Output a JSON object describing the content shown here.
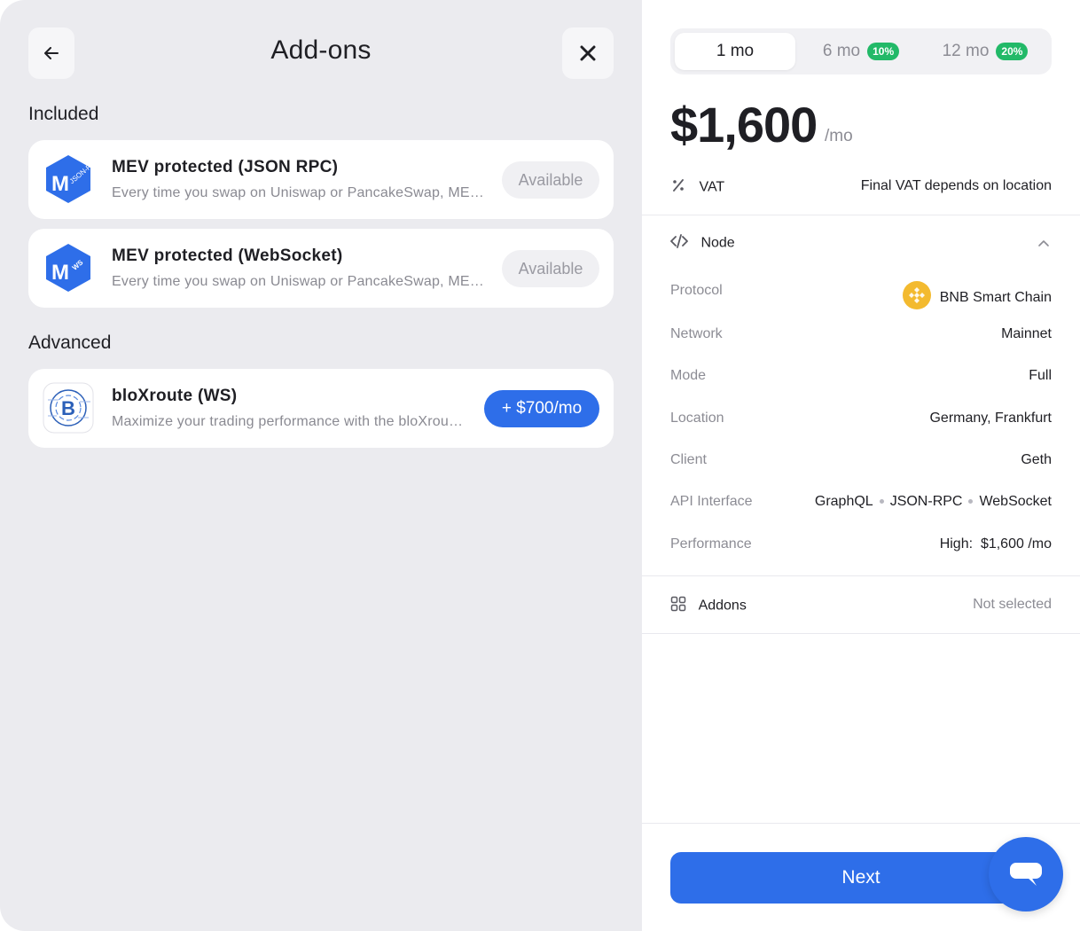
{
  "header": {
    "title": "Add-ons",
    "back_icon": "arrow-left-icon",
    "close_icon": "close-icon"
  },
  "included": {
    "label": "Included",
    "items": [
      {
        "name": "MEV protected (JSON RPC)",
        "description": "Every time you swap on Uniswap or PancakeSwap, MEV bots can front-run your transaction",
        "status": "Available",
        "logo_text": "JSON-RPC"
      },
      {
        "name": "MEV protected (WebSocket)",
        "description": "Every time you swap on Uniswap or PancakeSwap, MEV bots can front-run your transaction",
        "status": "Available",
        "logo_text": "WS"
      }
    ]
  },
  "advanced": {
    "label": "Advanced",
    "items": [
      {
        "name": "bloXroute (WS)",
        "description": "Maximize your trading performance with the bloXroute network",
        "price": "+ $700/mo"
      }
    ]
  },
  "summary": {
    "tabs": [
      {
        "label": "1 mo",
        "badge": "",
        "active": true
      },
      {
        "label": "6 mo",
        "badge": "10%",
        "active": false
      },
      {
        "label": "12 mo",
        "badge": "20%",
        "active": false
      }
    ],
    "price": "$1,600",
    "price_unit": "/mo",
    "vat": {
      "label": "VAT",
      "value": "Final VAT depends on location"
    },
    "node": {
      "label": "Node",
      "rows": [
        {
          "key": "Protocol",
          "value": "BNB Smart Chain"
        },
        {
          "key": "Network",
          "value": "Mainnet"
        },
        {
          "key": "Mode",
          "value": "Full"
        },
        {
          "key": "Location",
          "value": "Germany, Frankfurt"
        },
        {
          "key": "Client",
          "value": "Geth"
        },
        {
          "key": "API Interface",
          "values": [
            "GraphQL",
            "JSON-RPC",
            "WebSocket"
          ]
        },
        {
          "key": "Performance",
          "value_prefix": "High:",
          "value": "$1,600 /mo"
        }
      ]
    },
    "addons": {
      "label": "Addons",
      "value": "Not selected"
    },
    "next_label": "Next"
  },
  "colors": {
    "primary": "#2e6ee9",
    "badge_green": "#22b968",
    "bnb_yellow": "#f3ba2f"
  }
}
